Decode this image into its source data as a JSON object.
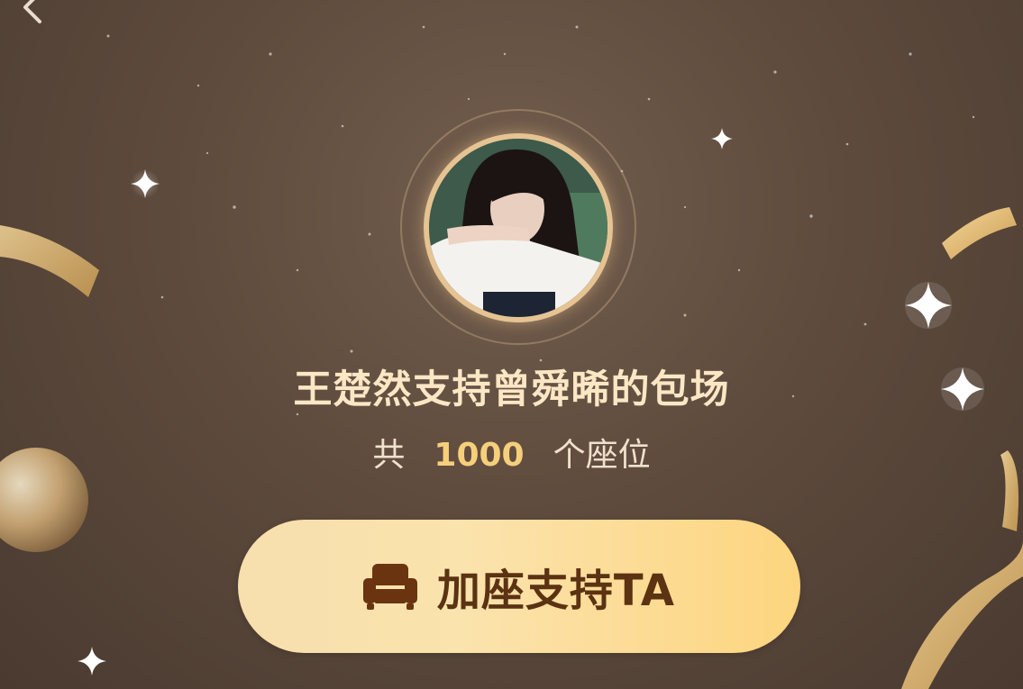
{
  "header": {
    "back_icon": "chevron-left-icon"
  },
  "profile": {
    "avatar": "avatar-photo",
    "title": "王楚然支持曾舜晞的包场"
  },
  "seats": {
    "prefix": "共",
    "count": "1000",
    "suffix": "个座位"
  },
  "cta": {
    "icon": "sofa-icon",
    "label": "加座支持TA"
  },
  "colors": {
    "background": "#5e4b3d",
    "title": "#fbe7c4",
    "count_highlight": "#f6cf7b",
    "button": "#fbe3ad",
    "button_text": "#5b3212"
  }
}
